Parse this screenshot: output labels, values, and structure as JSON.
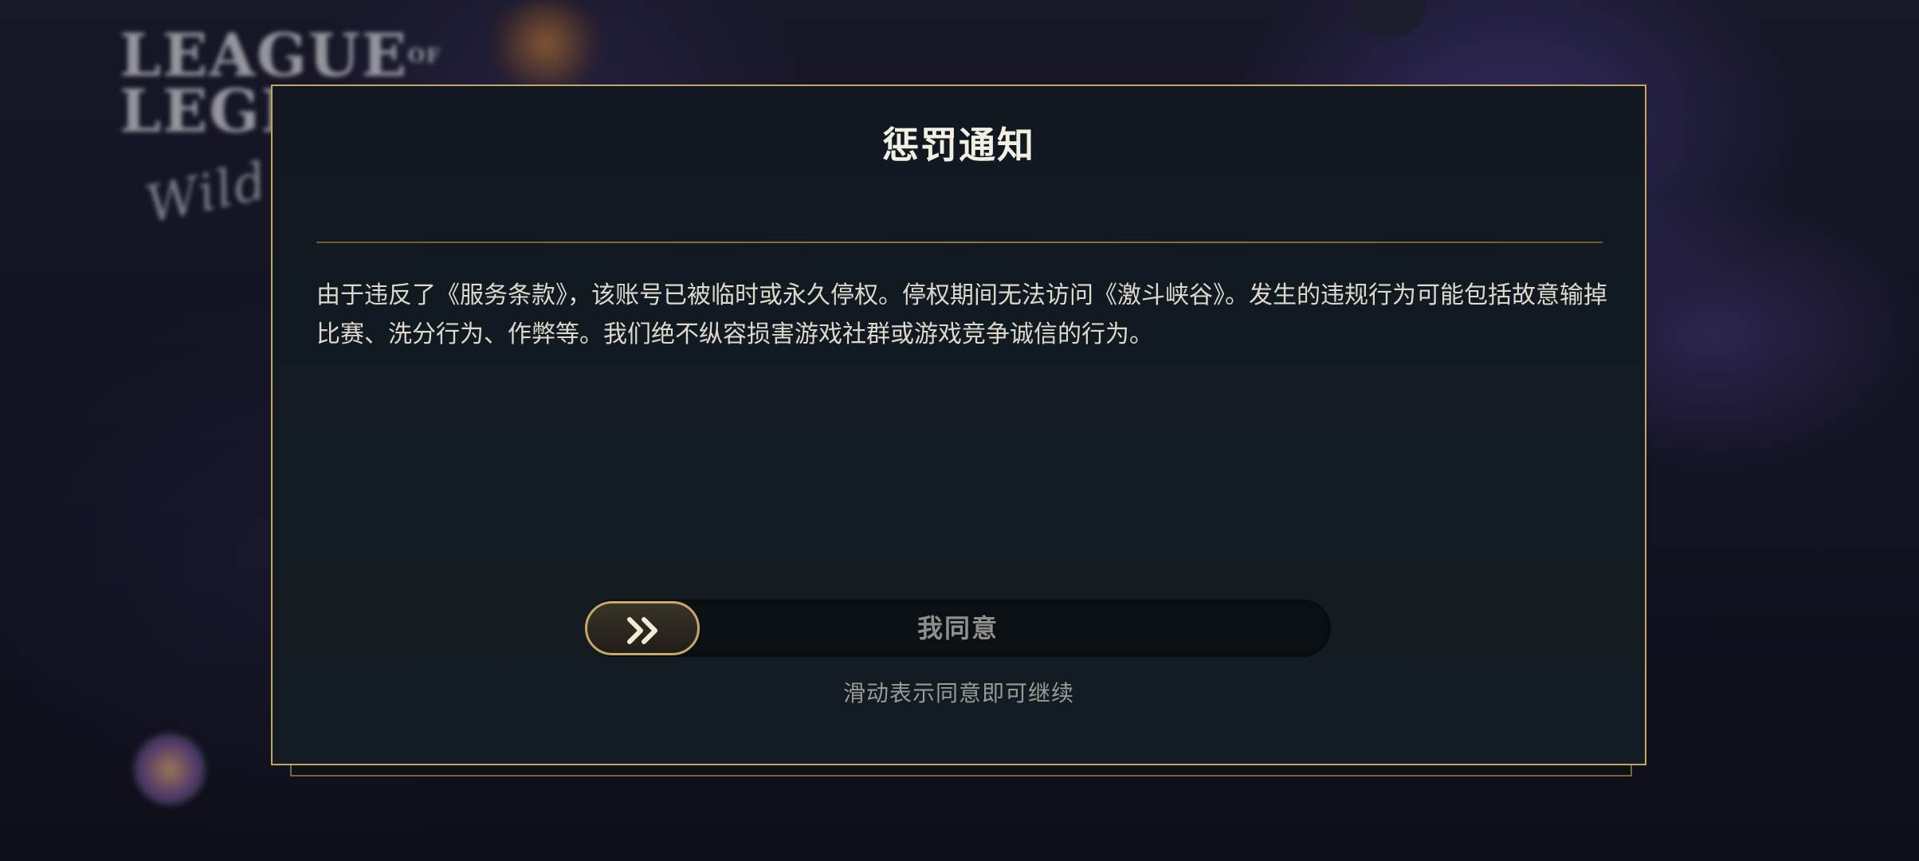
{
  "background": {
    "logo_line1": "LEAGUE",
    "logo_small": "OF",
    "logo_line2": "LEGENDS",
    "logo_script": "Wild Rift"
  },
  "dialog": {
    "title": "惩罚通知",
    "body": "由于违反了《服务条款》，该账号已被临时或永久停权。停权期间无法访问《激斗峡谷》。发生的违规行为可能包括故意输掉比赛、洗分行为、作弊等。我们绝不纵容损害游戏社群或游戏竞争诚信的行为。",
    "slider": {
      "label": "我同意",
      "handle_icon": "double-chevron-right-icon",
      "progress": 0
    },
    "hint": "滑动表示同意即可继续"
  },
  "colors": {
    "gold_border": "#c3a565",
    "panel_bg": "#131b22",
    "title_text": "#f2efe3",
    "body_text": "#ddd9cc",
    "hint_text": "#9a9a96"
  }
}
